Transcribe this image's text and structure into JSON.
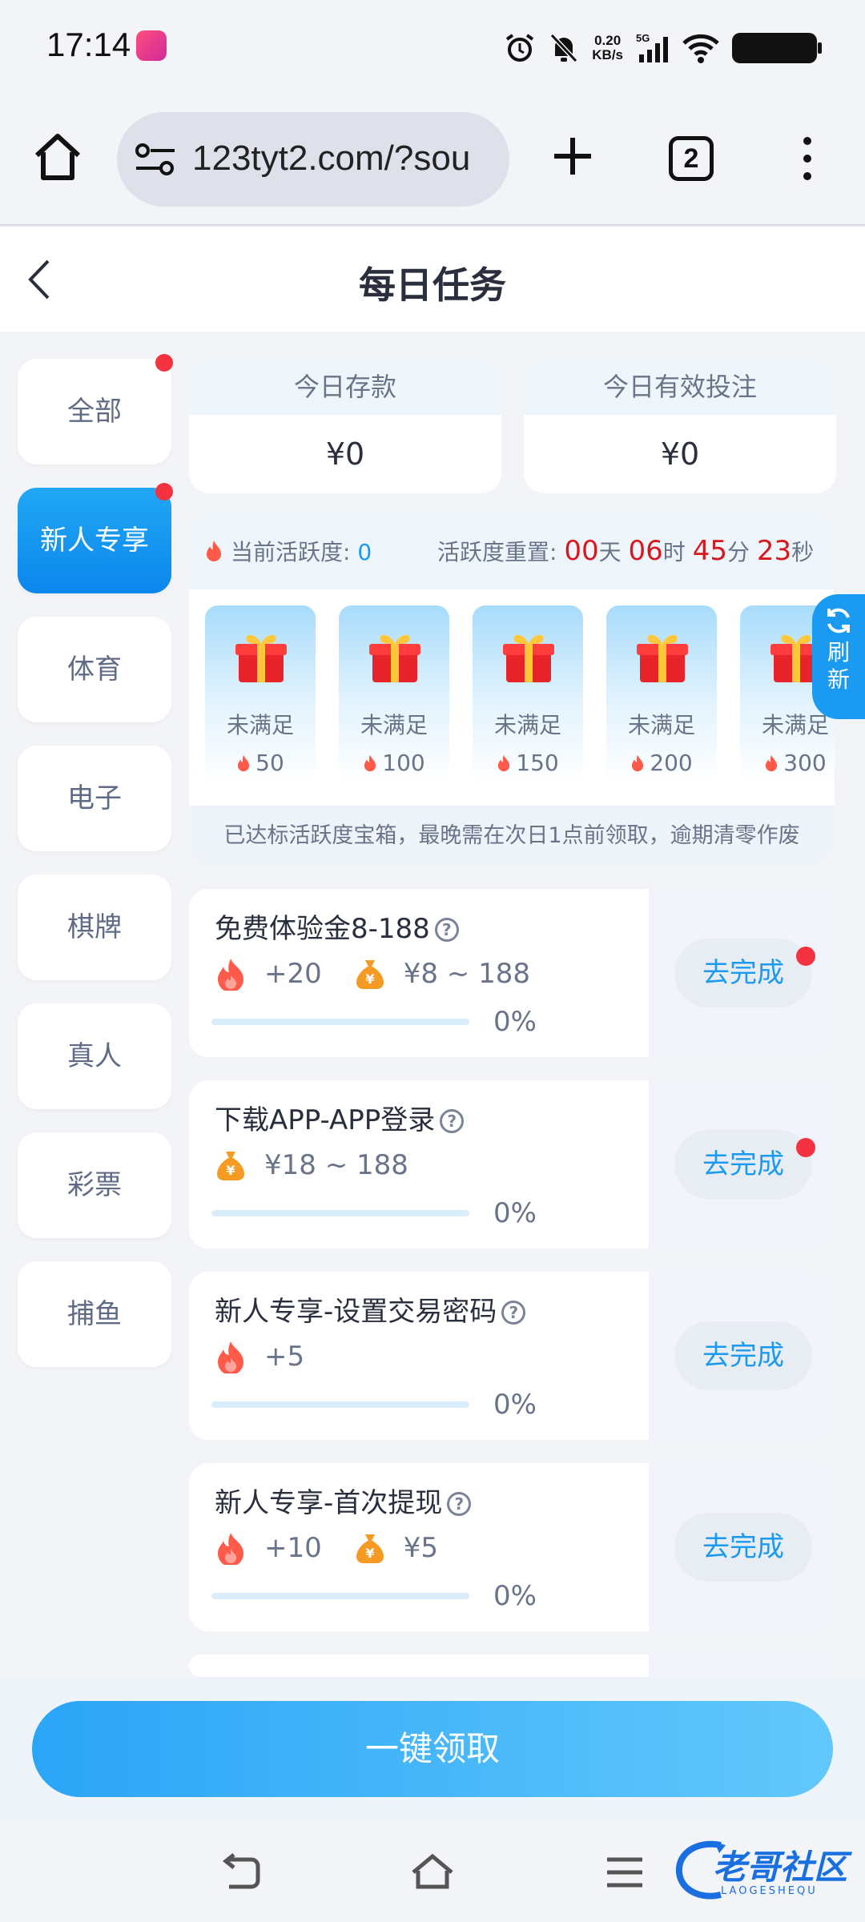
{
  "status_bar": {
    "time": "17:14",
    "net_speed": "0.20",
    "net_unit": "KB/s",
    "network": "5G"
  },
  "browser": {
    "url": "123tyt2.com/?sou",
    "tab_count": "2"
  },
  "header": {
    "title": "每日任务"
  },
  "sidebar": {
    "items": [
      {
        "label": "全部",
        "dot": true,
        "active": false
      },
      {
        "label": "新人专享",
        "dot": true,
        "active": true
      },
      {
        "label": "体育",
        "dot": false,
        "active": false
      },
      {
        "label": "电子",
        "dot": false,
        "active": false
      },
      {
        "label": "棋牌",
        "dot": false,
        "active": false
      },
      {
        "label": "真人",
        "dot": false,
        "active": false
      },
      {
        "label": "彩票",
        "dot": false,
        "active": false
      },
      {
        "label": "捕鱼",
        "dot": false,
        "active": false
      }
    ]
  },
  "stats": {
    "deposit_label": "今日存款",
    "deposit_value": "¥0",
    "bet_label": "今日有效投注",
    "bet_value": "¥0"
  },
  "activity": {
    "current_label": "当前活跃度:",
    "current_value": "0",
    "reset_label": "活跃度重置:",
    "days": "00",
    "days_unit": "天",
    "hours": "06",
    "hours_unit": "时",
    "minutes": "45",
    "minutes_unit": "分",
    "seconds": "23",
    "seconds_unit": "秒",
    "chests": [
      {
        "state": "未满足",
        "points": "50"
      },
      {
        "state": "未满足",
        "points": "100"
      },
      {
        "state": "未满足",
        "points": "150"
      },
      {
        "state": "未满足",
        "points": "200"
      },
      {
        "state": "未满足",
        "points": "300"
      }
    ],
    "note": "已达标活跃度宝箱，最晚需在次日1点前领取，逾期清零作废"
  },
  "refresh": {
    "line1": "刷",
    "line2": "新"
  },
  "tasks": [
    {
      "name": "免费体验金8-188",
      "activity": "+20",
      "money": "¥8 ~ 188",
      "progress": "0%",
      "progress_value": 0,
      "button": "去完成",
      "dot": true
    },
    {
      "name": "下载APP-APP登录",
      "activity": "",
      "money": "¥18 ~ 188",
      "progress": "0%",
      "progress_value": 0,
      "button": "去完成",
      "dot": true
    },
    {
      "name": "新人专享-设置交易密码",
      "activity": "+5",
      "money": "",
      "progress": "0%",
      "progress_value": 0,
      "button": "去完成",
      "dot": false
    },
    {
      "name": "新人专享-首次提现",
      "activity": "+10",
      "money": "¥5",
      "progress": "0%",
      "progress_value": 0,
      "button": "去完成",
      "dot": false
    }
  ],
  "claim_all": "一键领取",
  "watermark": {
    "text": "老哥社区",
    "sub": "LAOGESHEQU"
  },
  "colors": {
    "accent": "#1a9af0",
    "countdown": "#d8181f",
    "dot": "#f5323f"
  }
}
